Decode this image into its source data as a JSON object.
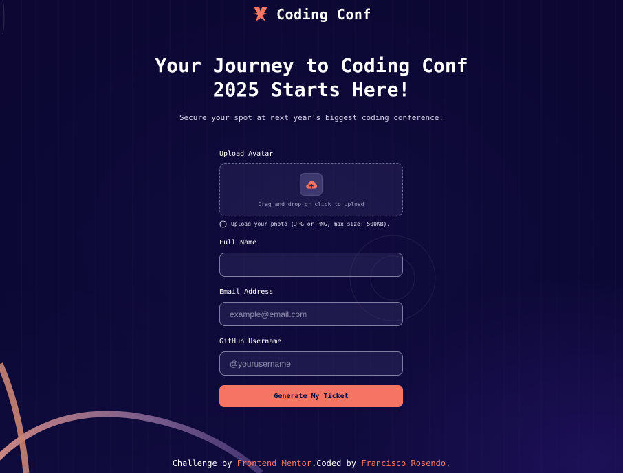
{
  "header": {
    "brand": "Coding Conf",
    "logo_icon": "coding-conf-logo-icon"
  },
  "hero": {
    "title_line1": "Your Journey to Coding Conf",
    "title_line2": "2025 Starts Here!",
    "subtitle": "Secure your spot at next year's biggest coding conference."
  },
  "form": {
    "avatar_label": "Upload Avatar",
    "upload_prompt": "Drag and drop or click to upload",
    "upload_icon": "cloud-upload-icon",
    "upload_hint": "Upload your photo (JPG or PNG, max size: 500KB).",
    "hint_icon": "info-icon",
    "full_name_label": "Full Name",
    "full_name_value": "",
    "full_name_placeholder": "",
    "email_label": "Email Address",
    "email_value": "",
    "email_placeholder": "example@email.com",
    "github_label": "GitHub Username",
    "github_value": "",
    "github_placeholder": "@yourusername",
    "submit_label": "Generate My Ticket"
  },
  "footer": {
    "prefix": "Challenge by ",
    "challenge_link": "Frontend Mentor",
    "middle": ".Coded by ",
    "author_link": "Francisco Rosendo",
    "suffix": "."
  },
  "colors": {
    "background": "#0d0937",
    "accent": "#f57463",
    "text": "#ffffff",
    "muted": "#d2d1e6"
  }
}
